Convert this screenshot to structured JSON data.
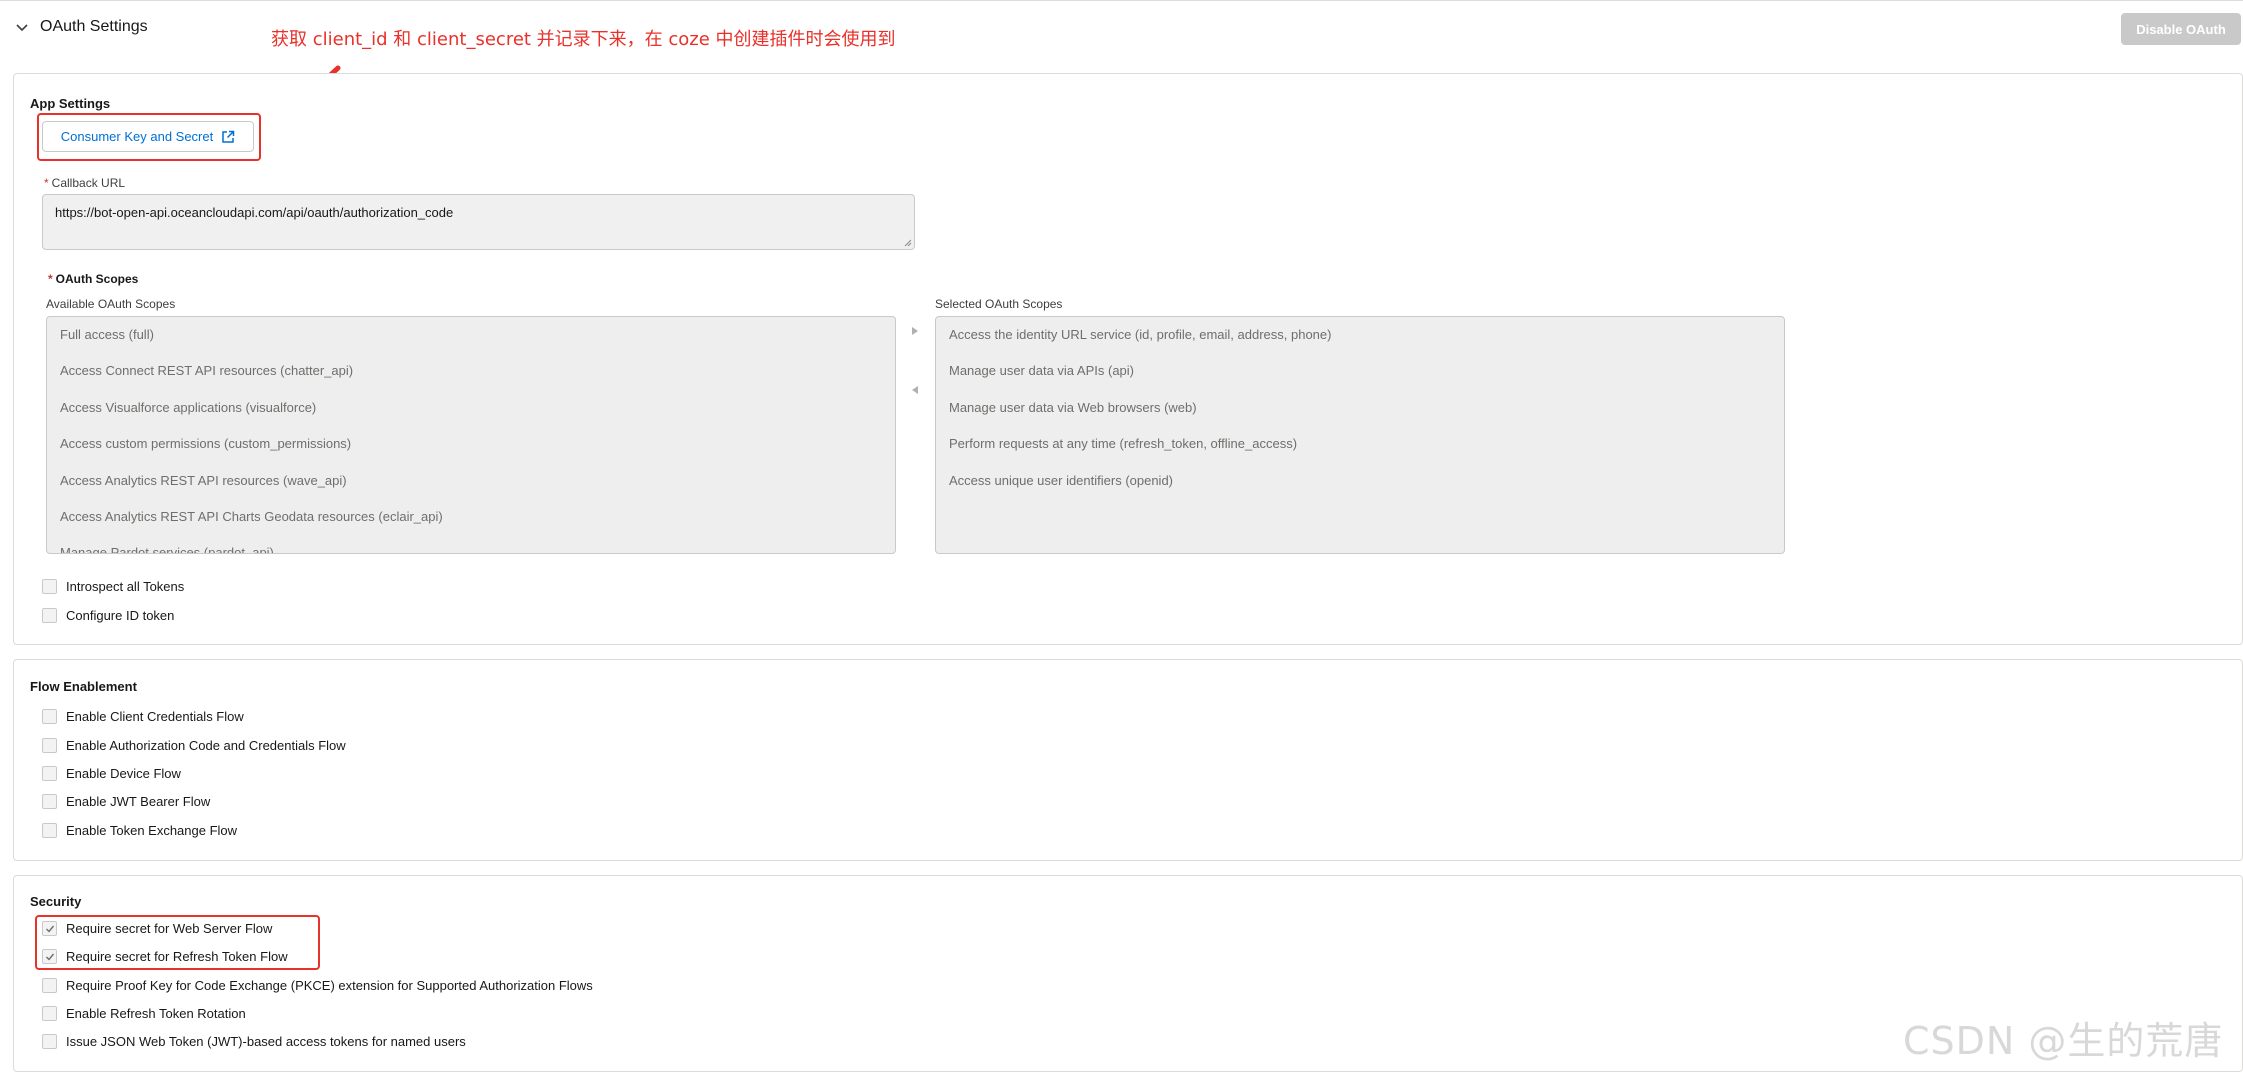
{
  "header": {
    "section_title": "OAuth Settings",
    "disable_button": "Disable OAuth",
    "annotation": "获取 client_id 和 client_secret 并记录下来，在 coze 中创建插件时会使用到"
  },
  "app_settings": {
    "title": "App Settings",
    "consumer_key_button": "Consumer Key and Secret",
    "callback_label": "Callback URL",
    "callback_value": "https://bot-open-api.oceancloudapi.com/api/oauth/authorization_code",
    "scopes_title": "OAuth Scopes",
    "available_label": "Available OAuth Scopes",
    "selected_label": "Selected OAuth Scopes",
    "available_scopes": [
      "Full access (full)",
      "Access Connect REST API resources (chatter_api)",
      "Access Visualforce applications (visualforce)",
      "Access custom permissions (custom_permissions)",
      "Access Analytics REST API resources (wave_api)",
      "Access Analytics REST API Charts Geodata resources (eclair_api)",
      "Manage Pardot services (pardot_api)"
    ],
    "selected_scopes": [
      "Access the identity URL service (id, profile, email, address, phone)",
      "Manage user data via APIs (api)",
      "Manage user data via Web browsers (web)",
      "Perform requests at any time (refresh_token, offline_access)",
      "Access unique user identifiers (openid)"
    ],
    "checkboxes": [
      {
        "label": "Introspect all Tokens",
        "checked": false
      },
      {
        "label": "Configure ID token",
        "checked": false
      }
    ]
  },
  "flow_enablement": {
    "title": "Flow Enablement",
    "checkboxes": [
      {
        "label": "Enable Client Credentials Flow",
        "checked": false
      },
      {
        "label": "Enable Authorization Code and Credentials Flow",
        "checked": false
      },
      {
        "label": "Enable Device Flow",
        "checked": false
      },
      {
        "label": "Enable JWT Bearer Flow",
        "checked": false
      },
      {
        "label": "Enable Token Exchange Flow",
        "checked": false
      }
    ]
  },
  "security": {
    "title": "Security",
    "checkboxes": [
      {
        "label": "Require secret for Web Server Flow",
        "checked": true
      },
      {
        "label": "Require secret for Refresh Token Flow",
        "checked": true
      },
      {
        "label": "Require Proof Key for Code Exchange (PKCE) extension for Supported Authorization Flows",
        "checked": false
      },
      {
        "label": "Enable Refresh Token Rotation",
        "checked": false
      },
      {
        "label": "Issue JSON Web Token (JWT)-based access tokens for named users",
        "checked": false
      }
    ]
  },
  "watermark": "CSDN @生的荒唐",
  "colors": {
    "annotation": "#e8312a",
    "link": "#0070d2",
    "required": "#c23934"
  }
}
